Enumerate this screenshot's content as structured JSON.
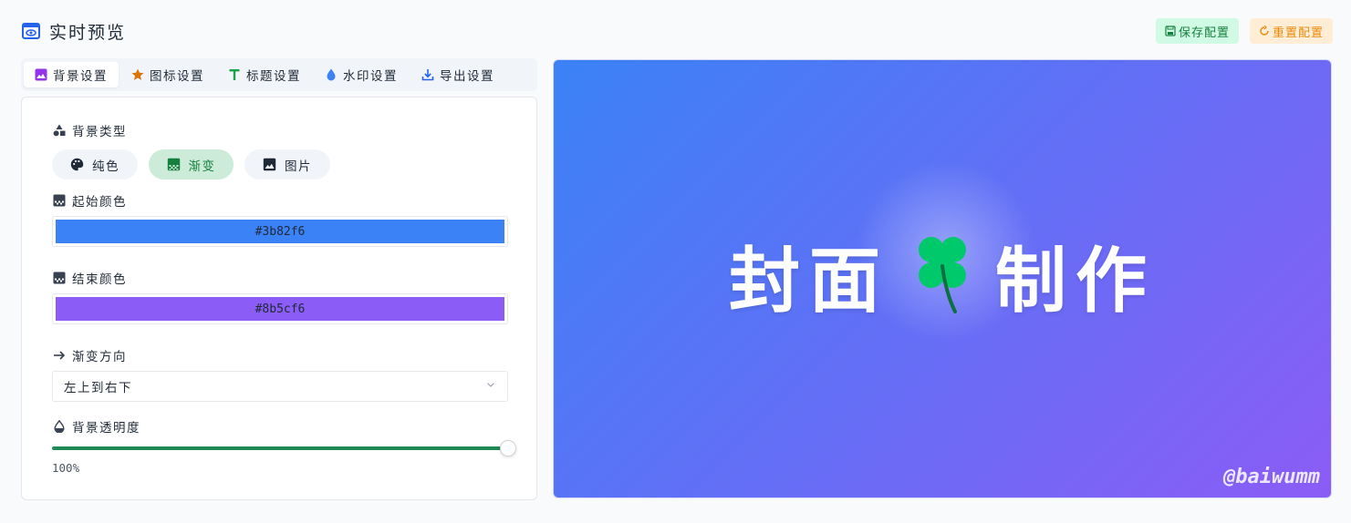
{
  "header": {
    "title": "实时预览",
    "save_label": "保存配置",
    "reset_label": "重置配置"
  },
  "tabs": [
    {
      "label": "背景设置",
      "icon": "image-icon",
      "active": true
    },
    {
      "label": "图标设置",
      "icon": "star-icon",
      "active": false
    },
    {
      "label": "标题设置",
      "icon": "text-icon",
      "active": false
    },
    {
      "label": "水印设置",
      "icon": "droplet-icon",
      "active": false
    },
    {
      "label": "导出设置",
      "icon": "download-icon",
      "active": false
    }
  ],
  "background": {
    "type_label": "背景类型",
    "types": [
      {
        "label": "纯色",
        "icon": "palette-icon",
        "active": false
      },
      {
        "label": "渐变",
        "icon": "gradient-icon",
        "active": true
      },
      {
        "label": "图片",
        "icon": "image-icon",
        "active": false
      }
    ],
    "start_color_label": "起始颜色",
    "start_color": "#3b82f6",
    "end_color_label": "结束颜色",
    "end_color": "#8b5cf6",
    "direction_label": "渐变方向",
    "direction_value": "左上到右下",
    "opacity_label": "背景透明度",
    "opacity_value": "100%",
    "opacity_fraction": 1.0
  },
  "preview": {
    "title_left": "封面",
    "title_right": "制作",
    "icon": "clover-icon",
    "watermark": "@baiwumm"
  },
  "colors": {
    "accent_green": "#1f8a53",
    "save_bg": "#d1fae5",
    "reset_bg": "#ffedd5"
  }
}
